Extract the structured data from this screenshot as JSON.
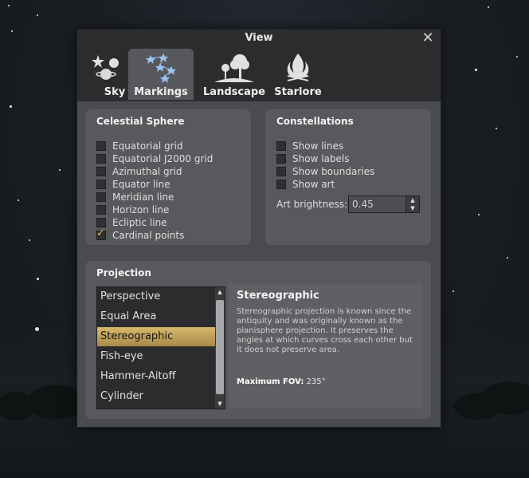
{
  "window": {
    "title": "View",
    "close_icon": "✕"
  },
  "tabs": [
    {
      "label": "Sky",
      "icon": "sky-icon"
    },
    {
      "label": "Markings",
      "icon": "markings-icon"
    },
    {
      "label": "Landscape",
      "icon": "landscape-icon"
    },
    {
      "label": "Starlore",
      "icon": "starlore-icon"
    }
  ],
  "celestial_sphere": {
    "title": "Celestial Sphere",
    "items": [
      {
        "label": "Equatorial grid",
        "checked": false
      },
      {
        "label": "Equatorial J2000 grid",
        "checked": false
      },
      {
        "label": "Azimuthal grid",
        "checked": false
      },
      {
        "label": "Equator line",
        "checked": false
      },
      {
        "label": "Meridian line",
        "checked": false
      },
      {
        "label": "Horizon line",
        "checked": false
      },
      {
        "label": "Ecliptic line",
        "checked": false
      },
      {
        "label": "Cardinal points",
        "checked": true
      }
    ]
  },
  "constellations": {
    "title": "Constellations",
    "items": [
      {
        "label": "Show lines",
        "checked": false
      },
      {
        "label": "Show labels",
        "checked": false
      },
      {
        "label": "Show boundaries",
        "checked": false
      },
      {
        "label": "Show art",
        "checked": false
      }
    ],
    "art_brightness_label": "Art brightness:",
    "art_brightness_value": "0.45"
  },
  "projection": {
    "title": "Projection",
    "items": [
      "Perspective",
      "Equal Area",
      "Stereographic",
      "Fish-eye",
      "Hammer-Aitoff",
      "Cylinder"
    ],
    "selected": "Stereographic",
    "description_title": "Stereographic",
    "description_body": "Stereographic projection is known since the antiquity and was originally known as the planisphere projection. It preserves the angles at which curves cross each other but it does not preserve area.",
    "max_fov_label": "Maximum FOV:",
    "max_fov_value": "235°"
  },
  "colors": {
    "accent_selected": "#c9a85a",
    "checkmark": "#e4c24b"
  }
}
